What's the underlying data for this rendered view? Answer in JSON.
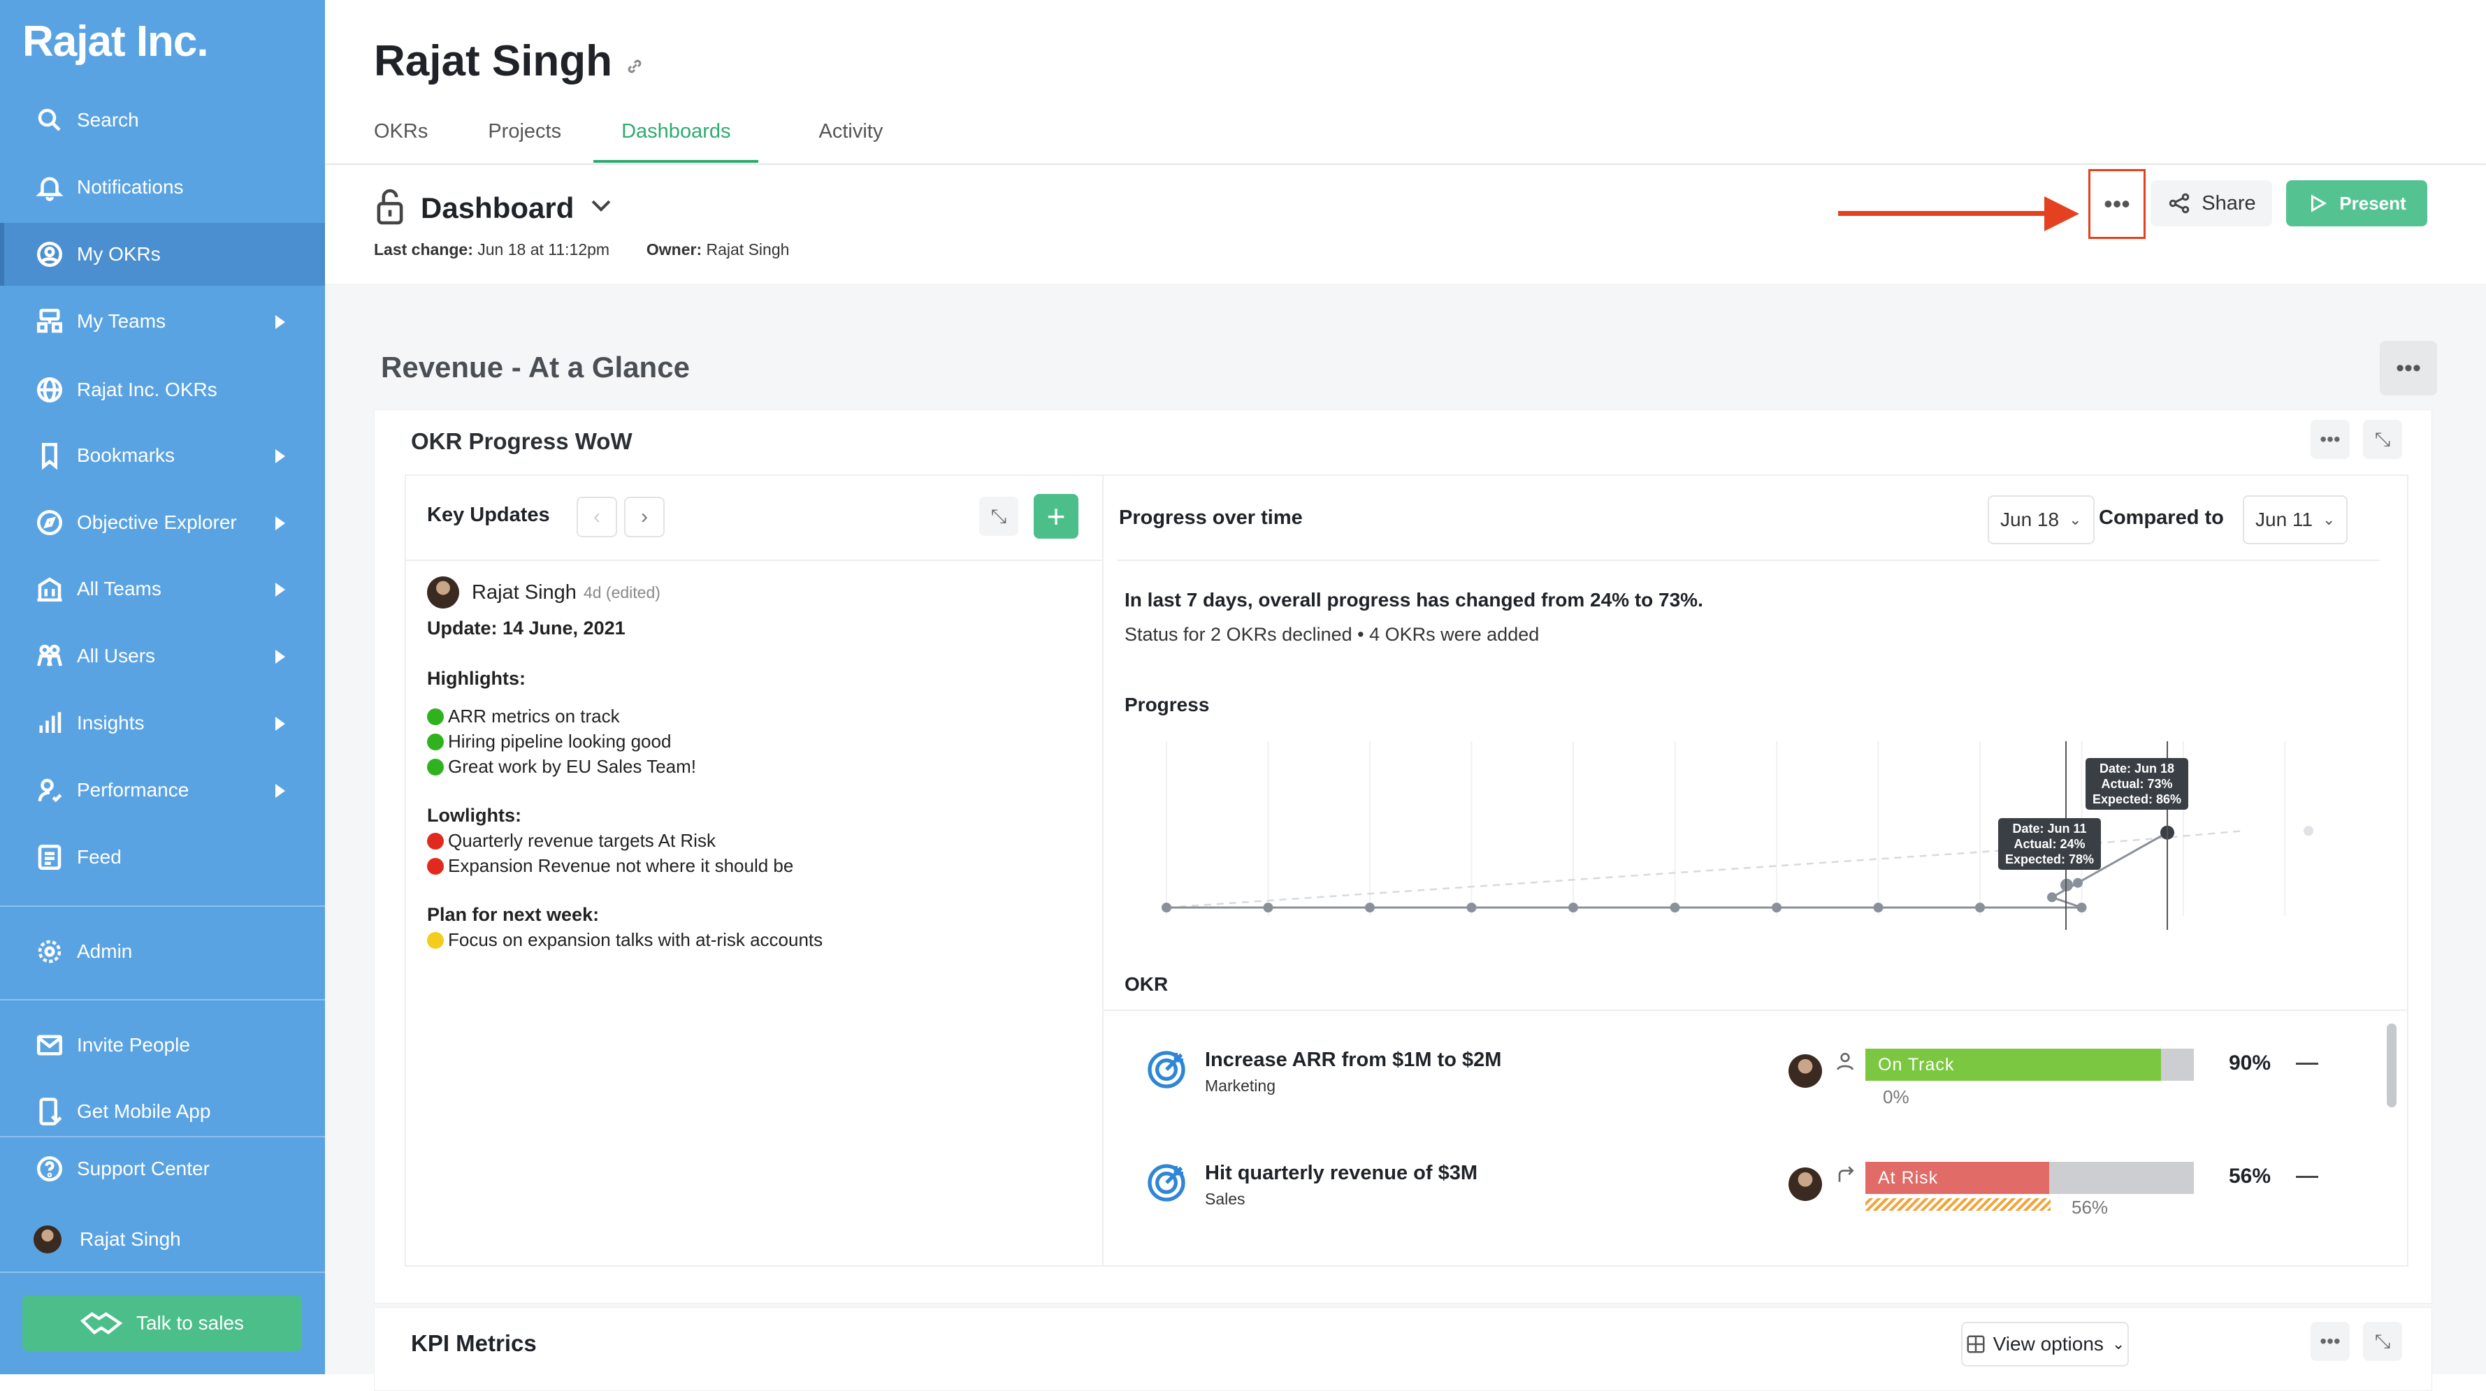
{
  "sidebar": {
    "brand": "Rajat Inc.",
    "items": [
      {
        "label": "Search"
      },
      {
        "label": "Notifications"
      },
      {
        "label": "My OKRs"
      },
      {
        "label": "My Teams"
      },
      {
        "label": "Rajat Inc. OKRs"
      },
      {
        "label": "Bookmarks"
      },
      {
        "label": "Objective Explorer"
      },
      {
        "label": "All Teams"
      },
      {
        "label": "All Users"
      },
      {
        "label": "Insights"
      },
      {
        "label": "Performance"
      },
      {
        "label": "Feed"
      }
    ],
    "admin": "Admin",
    "invite": "Invite People",
    "mobile": "Get Mobile App",
    "support": "Support Center",
    "user": "Rajat Singh",
    "talk": "Talk to sales"
  },
  "header": {
    "title": "Rajat Singh",
    "tabs": [
      "OKRs",
      "Projects",
      "Dashboards",
      "Activity"
    ]
  },
  "dashboard": {
    "title": "Dashboard",
    "last_change_label": "Last change:",
    "last_change": "Jun 18 at 11:12pm",
    "owner_label": "Owner:",
    "owner": "Rajat Singh",
    "more": "•••",
    "share": "Share",
    "present": "Present"
  },
  "section": {
    "title": "Revenue - At a Glance",
    "card_title": "OKR Progress WoW",
    "kpi_title": "KPI Metrics",
    "view_options": "View options"
  },
  "key_updates": {
    "title": "Key Updates",
    "author": "Rajat Singh",
    "when": "4d (edited)",
    "update_title": "Update: 14 June, 2021",
    "highlights_label": "Highlights:",
    "highlights": [
      "ARR metrics on track",
      "Hiring pipeline looking good",
      "Great work by EU Sales Team!"
    ],
    "lowlights_label": "Lowlights:",
    "lowlights": [
      "Quarterly revenue targets At Risk",
      "Expansion Revenue not where it should be"
    ],
    "plan_label": "Plan for next week:",
    "plan": [
      "Focus on expansion talks with at-risk accounts"
    ]
  },
  "progress": {
    "title": "Progress over time",
    "date": "Jun 18",
    "compared_label": "Compared to",
    "compared_date": "Jun 11",
    "summary": "In last 7 days, overall progress has changed from 24% to 73%.",
    "status": "Status for 2 OKRs declined • 4 OKRs were added",
    "chart_label": "Progress",
    "okr_label": "OKR"
  },
  "chart_data": {
    "type": "line",
    "series": [
      {
        "name": "Actual",
        "values": [
          0,
          0,
          0,
          0,
          0,
          0,
          0,
          0,
          0,
          0,
          10,
          24,
          73
        ]
      },
      {
        "name": "Expected",
        "values": [
          0,
          7,
          14,
          21,
          28,
          35,
          42,
          49,
          56,
          63,
          70,
          78,
          86,
          95
        ]
      }
    ],
    "ylim": [
      0,
      100
    ],
    "tooltips": [
      {
        "date": "Date: Jun 11",
        "actual": "Actual: 24%",
        "expected": "Expected: 78%"
      },
      {
        "date": "Date: Jun 18",
        "actual": "Actual: 73%",
        "expected": "Expected: 86%"
      }
    ]
  },
  "okrs": [
    {
      "name": "Increase ARR from $1M to $2M",
      "team": "Marketing",
      "status": "On Track",
      "progress": 90,
      "pct": "90%",
      "sub": "0%",
      "color": "#7cc742"
    },
    {
      "name": "Hit quarterly revenue of $3M",
      "team": "Sales",
      "status": "At Risk",
      "progress": 56,
      "pct": "56%",
      "sub": "56%",
      "color": "#e06b67"
    }
  ],
  "colors": {
    "sidebar": "#5aa3e3",
    "accent": "#2eab70",
    "annotation": "#e3411f"
  }
}
